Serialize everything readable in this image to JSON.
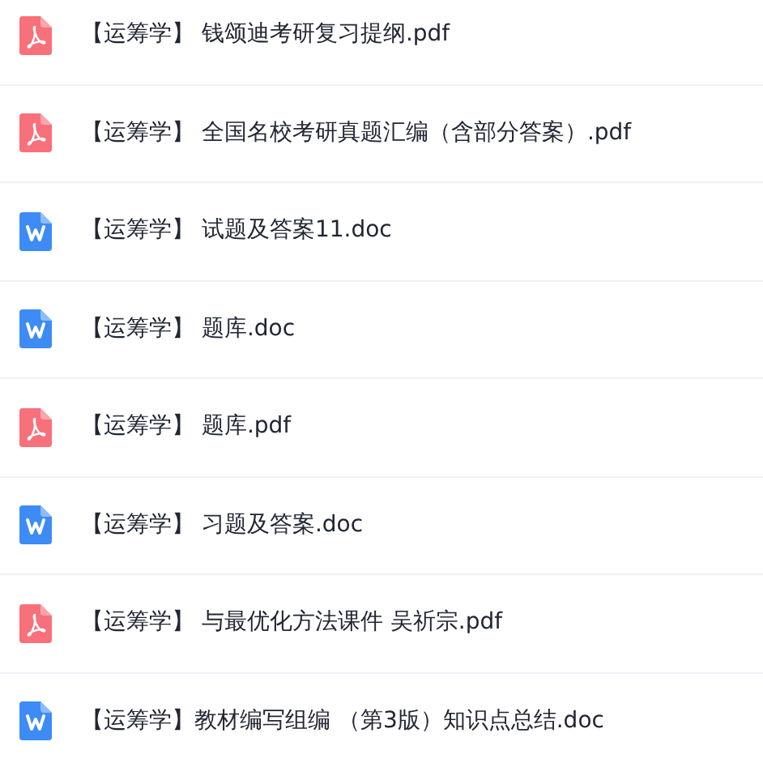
{
  "files": [
    {
      "kind": "pdf",
      "name": "【运筹学】 钱颂迪考研复习提纲.pdf"
    },
    {
      "kind": "pdf",
      "name": "【运筹学】 全国名校考研真题汇编（含部分答案）.pdf"
    },
    {
      "kind": "doc",
      "name": "【运筹学】 试题及答案11.doc"
    },
    {
      "kind": "doc",
      "name": "【运筹学】 题库.doc"
    },
    {
      "kind": "pdf",
      "name": "【运筹学】 题库.pdf"
    },
    {
      "kind": "doc",
      "name": "【运筹学】 习题及答案.doc"
    },
    {
      "kind": "pdf",
      "name": "【运筹学】 与最优化方法课件 吴祈宗.pdf"
    },
    {
      "kind": "doc",
      "name": "【运筹学】教材编写组编 （第3版）知识点总结.doc"
    }
  ]
}
